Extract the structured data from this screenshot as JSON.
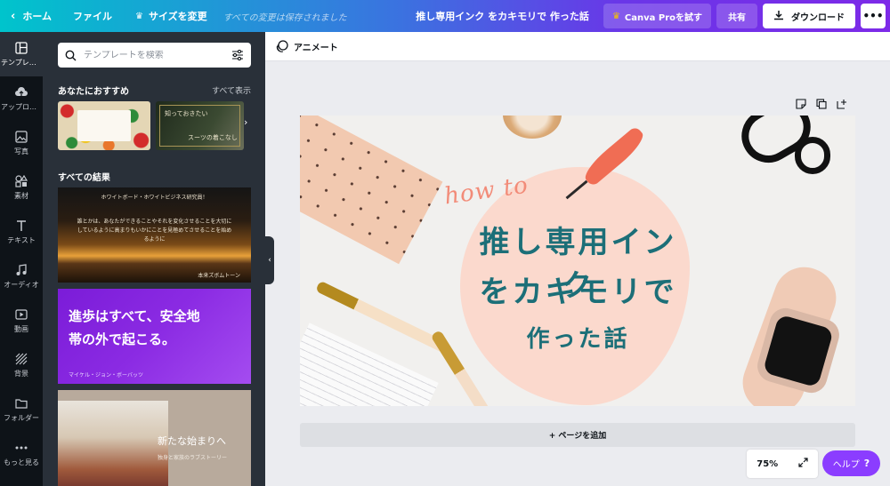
{
  "topbar": {
    "home_label": "ホーム",
    "file_label": "ファイル",
    "resize_label": "サイズを変更",
    "saved_status": "すべての変更は保存されました",
    "doc_title": "推し専用インク をカキモリで 作った話",
    "pro_label": "Canva Proを試す",
    "share_label": "共有",
    "download_label": "ダウンロード",
    "more_label": "•••"
  },
  "rail": {
    "items": [
      {
        "label": "テンプレート",
        "icon": "template-icon"
      },
      {
        "label": "アップロード",
        "icon": "upload-icon"
      },
      {
        "label": "写真",
        "icon": "photo-icon"
      },
      {
        "label": "素材",
        "icon": "elements-icon"
      },
      {
        "label": "テキスト",
        "icon": "text-icon"
      },
      {
        "label": "オーディオ",
        "icon": "audio-icon"
      },
      {
        "label": "動画",
        "icon": "video-icon"
      },
      {
        "label": "背景",
        "icon": "background-icon"
      },
      {
        "label": "フォルダー",
        "icon": "folder-icon"
      },
      {
        "label": "もっと見る",
        "icon": "more-icon"
      }
    ]
  },
  "panel": {
    "search_placeholder": "テンプレートを検索",
    "recommended_heading": "あなたにおすすめ",
    "see_all": "すべて表示",
    "recommended": [
      {
        "text": ""
      },
      {
        "line1": "知っておきたい",
        "line2": "スーツの着こなし"
      }
    ],
    "results_heading": "すべての結果",
    "results": [
      {
        "small_top": "ホワイトボード・ホワイトビジネス研究員！",
        "body": "誰とかは、あなたができることやそれを変化させることを大切にしているように高まりもいかにことを見極めてさせることを始めるように",
        "foot": "本来ズボムトーン"
      },
      {
        "big": "進歩はすべて、安全地帯の外で起こる。",
        "author": "マイケル・ジョン・ボーバッツ"
      },
      {
        "line1": "新たな始まりへ",
        "line2": "独身と家族のラブストーリー"
      }
    ]
  },
  "editor": {
    "animate_label": "アニメート",
    "canvas": {
      "howto": "how to",
      "title_line1": "推し専用インク",
      "title_line2": "をカキモリで",
      "title_line3": "作った話"
    },
    "add_page_label": "+ ページを追加",
    "zoom_value": "75%",
    "help_label": "ヘルプ",
    "help_q": "?"
  },
  "colors": {
    "topbar_start": "#00c4cc",
    "topbar_end": "#7d2ae8",
    "title_teal": "#1c6f78",
    "howto_coral": "#f28b78",
    "help_purple": "#8b3dff"
  }
}
